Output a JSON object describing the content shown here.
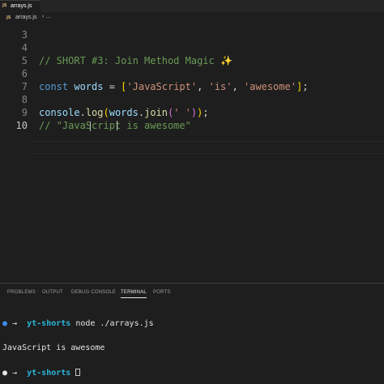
{
  "tab": {
    "icon": "JS",
    "filename": "arrays.js"
  },
  "breadcrumb": {
    "icon": "JS",
    "file": "arrays.js",
    "separator": "›",
    "more": "…"
  },
  "editor": {
    "lines": [
      {
        "num": "3"
      },
      {
        "num": "4"
      },
      {
        "num": "5",
        "comment": "// SHORT #3: Join Method Magic ",
        "emoji": "✨"
      },
      {
        "num": "6"
      },
      {
        "num": "7",
        "kw": "const",
        "var": "words",
        "eq": " = ",
        "br_open": "[",
        "s1": "'JavaScript'",
        "c1": ", ",
        "s2": "'is'",
        "c2": ", ",
        "s3": "'awesome'",
        "br_close": "]",
        "semi": ";"
      },
      {
        "num": "8"
      },
      {
        "num": "9",
        "obj": "console",
        "dot1": ".",
        "fn1": "log",
        "p1": "(",
        "arg": "words",
        "dot2": ".",
        "fn2": "join",
        "p2": "(",
        "str": "' '",
        "p3": ")",
        "p4": ")",
        "semi": ";"
      },
      {
        "num": "10",
        "comment": "// \"JavaScript is awesome\""
      }
    ]
  },
  "panel": {
    "tabs": [
      "PROBLEMS",
      "OUTPUT",
      "DEBUG CONSOLE",
      "TERMINAL",
      "PORTS"
    ],
    "active_tab": "TERMINAL"
  },
  "terminal": {
    "lines": [
      {
        "prompt": "●",
        "arrow": " → ",
        "dir": " yt-shorts",
        "cmd": " node ./arrays.js"
      },
      {
        "output": "JavaScript is awesome"
      },
      {
        "prompt": "●",
        "arrow": " → ",
        "dir": " yt-shorts",
        "cmd": " "
      }
    ]
  },
  "colors": {
    "background": "#1e1e1e",
    "comment": "#6a9955",
    "keyword": "#569cd6",
    "string": "#ce9178",
    "function": "#dcdcaa",
    "bracket_1": "#ffd700",
    "bracket_2": "#da70d6",
    "prompt_dir": "#29b8db"
  }
}
